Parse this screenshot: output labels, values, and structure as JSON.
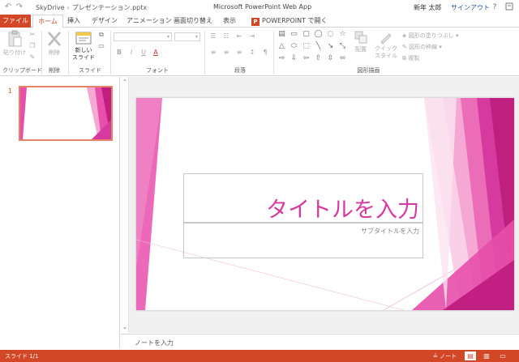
{
  "titlebar": {
    "breadcrumb_root": "SkyDrive",
    "breadcrumb_file": "プレゼンテーション.pptx",
    "app_title": "Microsoft PowerPoint Web App",
    "user_name": "新年 太郎",
    "sign_in": "サインアウト",
    "help": "?"
  },
  "tabs": {
    "file": "ファイル",
    "home": "ホーム",
    "insert": "挿入",
    "design": "デザイン",
    "animation": "アニメーション",
    "transition": "画面切り替え",
    "view": "表示",
    "open_in_ppt": "POWERPOINT で開く"
  },
  "ribbon": {
    "clipboard": {
      "paste": "貼り付け",
      "label": "クリップボード"
    },
    "delete": {
      "delete_button": "削除",
      "label": "削除"
    },
    "slides": {
      "new_slide_line1": "新しい",
      "new_slide_line2": "スライド",
      "label": "スライド"
    },
    "font": {
      "label": "フォント",
      "bold": "B",
      "italic": "I",
      "underline": "U",
      "font_color": "A"
    },
    "paragraph": {
      "label": "段落"
    },
    "drawing": {
      "label": "図形描画",
      "arrange": "配置",
      "quick_styles_line1": "クイック",
      "quick_styles_line2": "スタイル",
      "shape_fill": "図形の塗りつぶし",
      "shape_outline": "図形の枠線",
      "duplicate": "複製"
    }
  },
  "thumbnails": {
    "slide_number": "1"
  },
  "slide": {
    "title_placeholder": "タイトルを入力",
    "subtitle_placeholder": "サブタイトルを入力"
  },
  "notes": {
    "placeholder": "ノートを入力"
  },
  "statusbar": {
    "slide_count": "スライド 1/1",
    "notes": "ノート"
  },
  "colors": {
    "accent": "#d24726",
    "title_text": "#d63a9e",
    "pink_light": "#f5a8d4",
    "pink_mid": "#e74fab",
    "pink_dark": "#bf1f7f"
  }
}
